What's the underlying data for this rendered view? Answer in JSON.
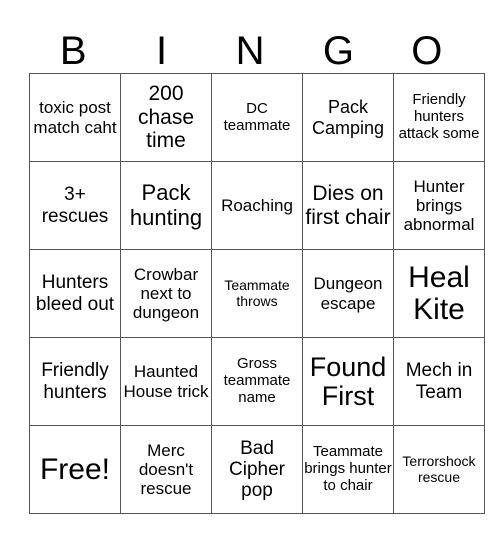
{
  "title_letters": [
    "B",
    "I",
    "N",
    "G",
    "O"
  ],
  "rows": [
    [
      "toxic post match caht",
      "200 chase time",
      "DC teammate",
      "Pack Camping",
      "Friendly hunters attack some"
    ],
    [
      "3+ rescues",
      "Pack hunting",
      "Roaching",
      "Dies on first chair",
      "Hunter brings abnormal"
    ],
    [
      "Hunters bleed out",
      "Crowbar next to dungeon",
      "Teammate throws",
      "Dungeon escape",
      "Heal Kite"
    ],
    [
      "Friendly hunters",
      "Haunted House trick",
      "Gross teammate name",
      "Found First",
      "Mech in Team"
    ],
    [
      "Free!",
      "Merc doesn't rescue",
      "Bad Cipher pop",
      "Teammate brings hunter to chair",
      "Terrorshock rescue"
    ]
  ]
}
